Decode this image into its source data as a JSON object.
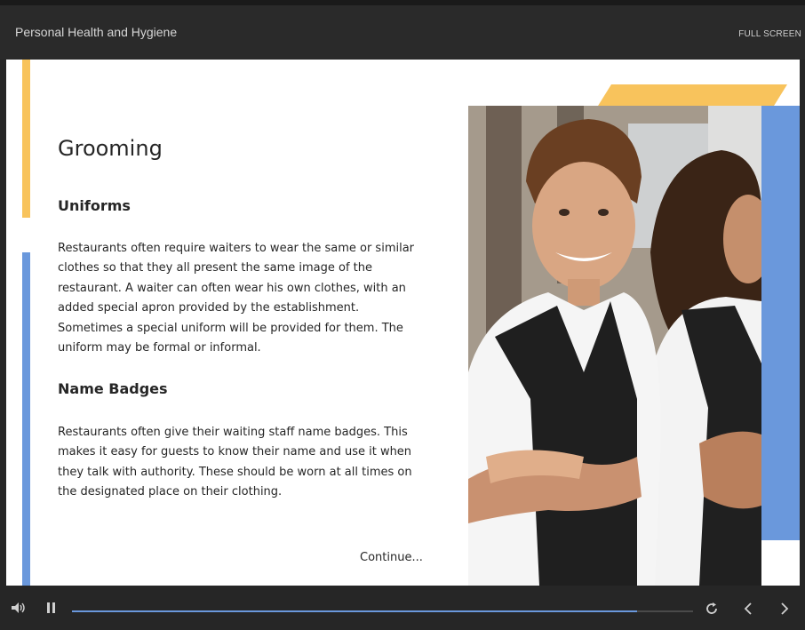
{
  "header": {
    "course_title": "Personal Health and Hygiene",
    "fullscreen_label": "FULL SCREEN"
  },
  "slide": {
    "heading": "Grooming",
    "sections": [
      {
        "title": "Uniforms",
        "body": "Restaurants often require waiters to wear the same or similar clothes so that they all present the same image of the restaurant. A waiter can often wear his own clothes, with an added special apron provided by the establishment. Sometimes a special uniform will be provided for them. The uniform may be formal or informal."
      },
      {
        "title": "Name Badges",
        "body": "Restaurants often give their waiting staff name badges. This makes it easy for guests to know their name and use it when they talk with authority. These should be worn at all times on the designated place on their clothing."
      }
    ],
    "continue_label": "Continue..."
  },
  "player": {
    "progress": 0.91,
    "icons": {
      "volume": "volume-icon",
      "pause": "pause-icon",
      "replay": "replay-icon",
      "prev": "chevron-left-icon",
      "next": "chevron-right-icon"
    }
  },
  "colors": {
    "accent_yellow": "#f8c35c",
    "accent_blue": "#6a98dc",
    "chrome": "#262626"
  }
}
